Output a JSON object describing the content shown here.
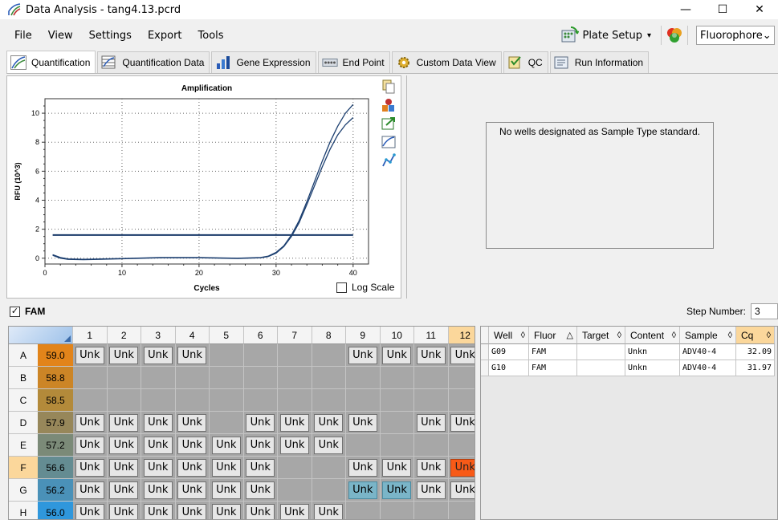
{
  "window": {
    "title": "Data Analysis - tang4.13.pcrd",
    "minimize": "—",
    "maximize": "☐",
    "close": "✕"
  },
  "menu": {
    "items": [
      "File",
      "View",
      "Settings",
      "Export",
      "Tools"
    ],
    "plate_setup": "Plate Setup",
    "dropdown_arrow": "▾",
    "fluorophore": "Fluorophore",
    "fluorophore_arrow": "⌄"
  },
  "tabs": [
    "Quantification",
    "Quantification Data",
    "Gene Expression",
    "End Point",
    "Custom Data View",
    "QC",
    "Run Information"
  ],
  "chart_data": {
    "type": "line",
    "title": "Amplification",
    "xlabel": "Cycles",
    "ylabel": "RFU (10^3)",
    "xlim": [
      0,
      42
    ],
    "ylim": [
      -0.4,
      11
    ],
    "xticks": [
      0,
      10,
      20,
      30,
      40
    ],
    "yticks": [
      0,
      2,
      4,
      6,
      8,
      10
    ],
    "grid": true,
    "threshold": 1.6,
    "series": [
      {
        "x": [
          1,
          2,
          3,
          5,
          10,
          15,
          20,
          25,
          28,
          29,
          30,
          31,
          32,
          33,
          34,
          35,
          36,
          37,
          38,
          39,
          40
        ],
        "values": [
          0.25,
          0.05,
          -0.05,
          -0.08,
          -0.02,
          0.05,
          0.05,
          0.0,
          0.05,
          0.15,
          0.4,
          0.85,
          1.6,
          2.6,
          3.9,
          5.3,
          6.7,
          8.0,
          9.1,
          10.0,
          10.6
        ]
      },
      {
        "x": [
          1,
          2,
          3,
          5,
          10,
          15,
          20,
          25,
          28,
          29,
          30,
          31,
          32,
          33,
          34,
          35,
          36,
          37,
          38,
          39,
          40
        ],
        "values": [
          0.2,
          0.0,
          -0.08,
          -0.1,
          -0.04,
          0.03,
          0.03,
          -0.02,
          0.03,
          0.12,
          0.35,
          0.8,
          1.5,
          2.45,
          3.7,
          5.0,
          6.3,
          7.5,
          8.5,
          9.2,
          9.7
        ]
      }
    ]
  },
  "log_scale": {
    "label": "Log Scale",
    "checked": false
  },
  "no_standard": "No wells designated as Sample Type standard.",
  "fam": {
    "label": "FAM",
    "checked": true,
    "check_mark": "✓"
  },
  "step": {
    "label": "Step Number:",
    "value": "3"
  },
  "plate": {
    "columns": [
      "1",
      "2",
      "3",
      "4",
      "5",
      "6",
      "7",
      "8",
      "9",
      "10",
      "11",
      "12"
    ],
    "rows": [
      {
        "label": "A",
        "temp": "59.0",
        "color": "#e2841a",
        "wells": [
          1,
          1,
          1,
          1,
          0,
          0,
          0,
          0,
          1,
          1,
          1,
          1
        ]
      },
      {
        "label": "B",
        "temp": "58.8",
        "color": "#cc8526",
        "wells": [
          0,
          0,
          0,
          0,
          0,
          0,
          0,
          0,
          0,
          0,
          0,
          0
        ]
      },
      {
        "label": "C",
        "temp": "58.5",
        "color": "#b38a3a",
        "wells": [
          0,
          0,
          0,
          0,
          0,
          0,
          0,
          0,
          0,
          0,
          0,
          0
        ]
      },
      {
        "label": "D",
        "temp": "57.9",
        "color": "#97875a",
        "wells": [
          1,
          1,
          1,
          1,
          0,
          1,
          1,
          1,
          1,
          0,
          1,
          1
        ]
      },
      {
        "label": "E",
        "temp": "57.2",
        "color": "#7b8a78",
        "wells": [
          1,
          1,
          1,
          1,
          1,
          1,
          1,
          1,
          0,
          0,
          0,
          0
        ]
      },
      {
        "label": "F",
        "temp": "56.6",
        "color": "#648c92",
        "wells": [
          1,
          1,
          1,
          1,
          1,
          1,
          0,
          0,
          1,
          1,
          1,
          2
        ]
      },
      {
        "label": "G",
        "temp": "56.2",
        "color": "#4a91b8",
        "wells": [
          1,
          1,
          1,
          1,
          1,
          1,
          0,
          0,
          3,
          3,
          1,
          1
        ]
      },
      {
        "label": "H",
        "temp": "56.0",
        "color": "#2f97dc",
        "wells": [
          1,
          1,
          1,
          1,
          1,
          1,
          1,
          1,
          0,
          0,
          0,
          0
        ]
      }
    ],
    "unk_label": "Unk",
    "highlight_row": "F",
    "highlight_col": "12"
  },
  "results": {
    "headers": [
      {
        "label": "Well",
        "sort": "◊"
      },
      {
        "label": "Fluor",
        "sort": "△"
      },
      {
        "label": "Target",
        "sort": "◊"
      },
      {
        "label": "Content",
        "sort": "◊"
      },
      {
        "label": "Sample",
        "sort": "◊"
      },
      {
        "label": "Cq",
        "sort": "◊"
      }
    ],
    "rows": [
      {
        "well": "G09",
        "fluor": "FAM",
        "target": "",
        "content": "Unkn",
        "sample": "ADV40-4",
        "cq": "32.09"
      },
      {
        "well": "G10",
        "fluor": "FAM",
        "target": "",
        "content": "Unkn",
        "sample": "ADV40-4",
        "cq": "31.97"
      }
    ]
  }
}
